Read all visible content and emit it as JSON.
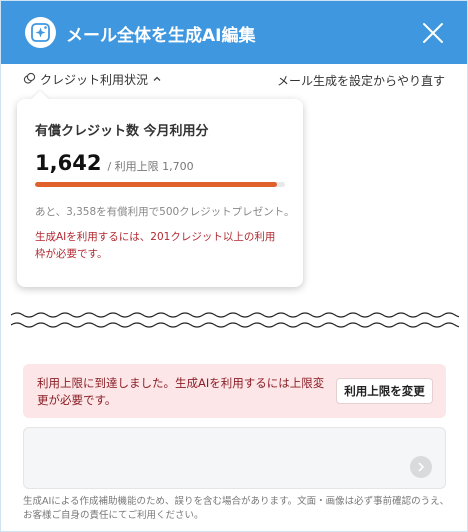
{
  "header": {
    "title": "メール全体を生成AI編集",
    "logo_icon": "ai-sparkle-icon",
    "close_icon": "close-icon"
  },
  "toolbar": {
    "credit_status_label": "クレジット利用状況",
    "settings_link": "メール生成を設定からやり直す"
  },
  "credit_popover": {
    "title": "有償クレジット数 今月利用分",
    "used": "1,642",
    "limit_text": "/ 利用上限 1,700",
    "usage_fraction": 0.966,
    "note": "あと、3,358を有償利用で500クレジットプレゼント。",
    "warning": "生成AIを利用するには、201クレジット以上の利用枠が必要です。"
  },
  "alert": {
    "message": "利用上限に到達しました。生成AIを利用するには上限変更が必要です。",
    "button_label": "利用上限を変更"
  },
  "footer": {
    "disclaimer": "生成AIによる作成補助機能のため、誤りを含む場合があります。文面・画像は必ず事前確認のうえ、お客様ご自身の責任にてご利用ください。"
  },
  "colors": {
    "header_bg": "#3f97df",
    "progress": "#e0602c",
    "warning_text": "#b12a32",
    "alert_bg": "#fce6e7"
  }
}
